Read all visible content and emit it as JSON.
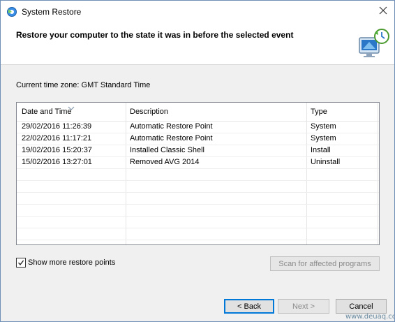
{
  "window": {
    "title": "System Restore",
    "app_icon": "system-restore-icon",
    "close_icon": "close-icon"
  },
  "header": {
    "heading": "Restore your computer to the state it was in before the selected event",
    "graphic": "system-restore-graphic"
  },
  "timezone": "Current time zone: GMT Standard Time",
  "list": {
    "columns": [
      "Date and Time",
      "Description",
      "Type"
    ],
    "sort_indicator": "sort-arrow-icon",
    "rows": [
      {
        "date": "29/02/2016 11:26:39",
        "description": "Automatic Restore Point",
        "type": "System"
      },
      {
        "date": "22/02/2016 11:17:21",
        "description": "Automatic Restore Point",
        "type": "System"
      },
      {
        "date": "19/02/2016 15:20:37",
        "description": "Installed Classic Shell",
        "type": "Install"
      },
      {
        "date": "15/02/2016 13:27:01",
        "description": "Removed AVG 2014",
        "type": "Uninstall"
      }
    ]
  },
  "show_more": {
    "label": "Show more restore points",
    "checked": true
  },
  "buttons": {
    "scan": "Scan for affected programs",
    "back": "< Back",
    "next": "Next >",
    "cancel": "Cancel"
  },
  "watermark": "www.deuaq.com",
  "colors": {
    "accent": "#0078d7",
    "window_border": "#6f8fb6",
    "dialog_bg": "#f0f0f0"
  }
}
